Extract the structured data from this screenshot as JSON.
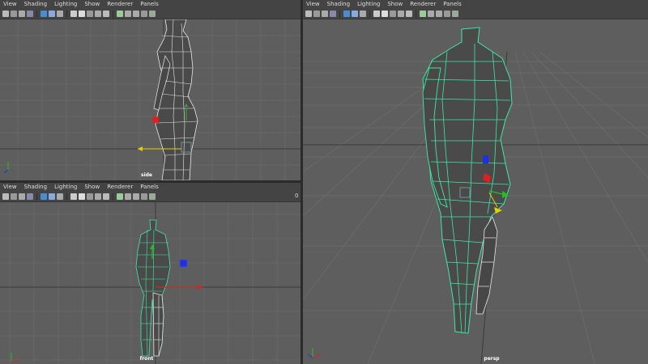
{
  "menu": [
    "View",
    "Shading",
    "Lighting",
    "Show",
    "Renderer",
    "Panels"
  ],
  "panels": {
    "side": {
      "camera": "side"
    },
    "front": {
      "camera": "front"
    },
    "persp": {
      "camera": "persp"
    }
  },
  "colors": {
    "viewport_bg": "#5e5e5e",
    "grid": "#6e6e6e",
    "grid_axis": "#3a3a3a",
    "mesh_fill": "#4a4a4a",
    "wire": "#e8e8e8",
    "selected_wire": "#41e6a8",
    "x_axis": "#e02020",
    "y_axis": "#20c020",
    "z_axis": "#2030e0",
    "yellow": "#e0d000"
  },
  "toolbar_icons": [
    "camera-icon",
    "lock-icon",
    "bookmark-icon",
    "image-plane-icon",
    "grid-toggle-icon",
    "film-gate-icon",
    "resolution-gate-icon",
    "wireframe-icon",
    "smooth-shade-icon",
    "textured-icon",
    "lights-icon",
    "shadows-icon",
    "isolate-icon",
    "xray-icon",
    "joint-xray-icon",
    "backface-icon",
    "gamma-icon"
  ],
  "front_toolbar_extra": "0"
}
